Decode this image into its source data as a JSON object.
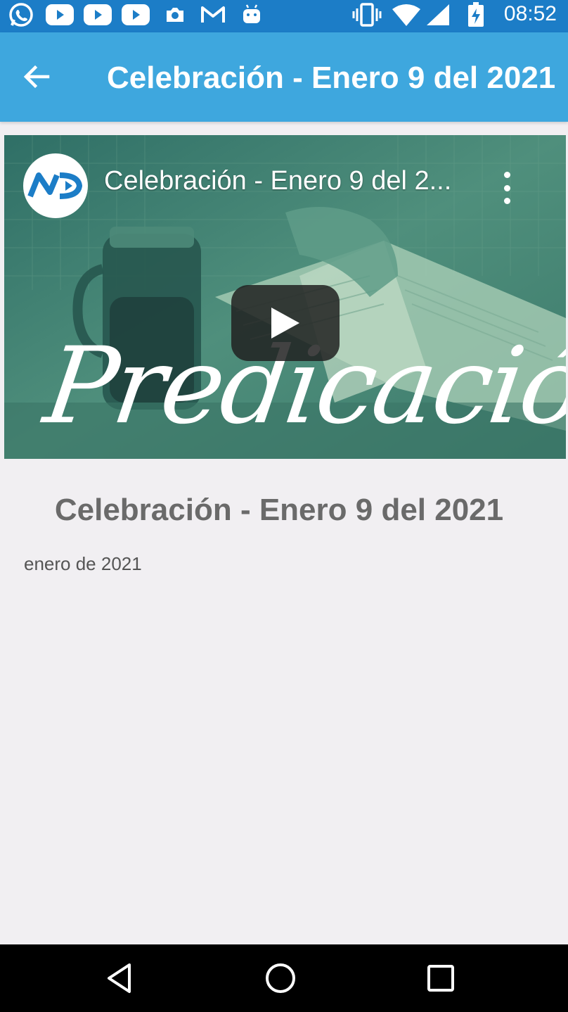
{
  "status_bar": {
    "time": "08:52",
    "left_icons": [
      "whatsapp-icon",
      "youtube-icon",
      "youtube-icon",
      "youtube-icon",
      "camera-icon",
      "gmail-icon",
      "android-icon"
    ],
    "right_icons": [
      "vibrate-icon",
      "wifi-icon",
      "signal-icon",
      "battery-charging-icon"
    ]
  },
  "app_bar": {
    "title": "Celebración - Enero 9 del 2021"
  },
  "video": {
    "title": "Celebración - Enero 9 del 2...",
    "overlay_text": "Predicación",
    "channel_logo": "NDV"
  },
  "content": {
    "title": "Celebración - Enero 9 del 2021",
    "date": "enero de 2021"
  },
  "colors": {
    "status_bar": "#1c7dc7",
    "app_bar": "#3ea7de",
    "background": "#f1eff2",
    "title_text": "#6a6a6a"
  }
}
